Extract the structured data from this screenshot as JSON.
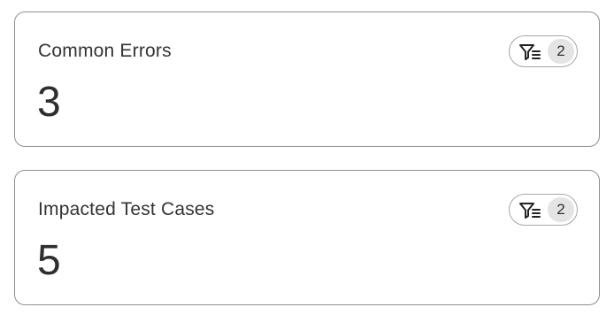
{
  "cards": [
    {
      "title": "Common Errors",
      "value": "3",
      "filter": {
        "icon": "filter-list-icon",
        "count": "2"
      }
    },
    {
      "title": "Impacted Test Cases",
      "value": "5",
      "filter": {
        "icon": "filter-list-icon",
        "count": "2"
      }
    }
  ],
  "colors": {
    "border": "#8f8f8f",
    "text": "#2e2e2e",
    "badge_bg": "#e4e4e4"
  }
}
